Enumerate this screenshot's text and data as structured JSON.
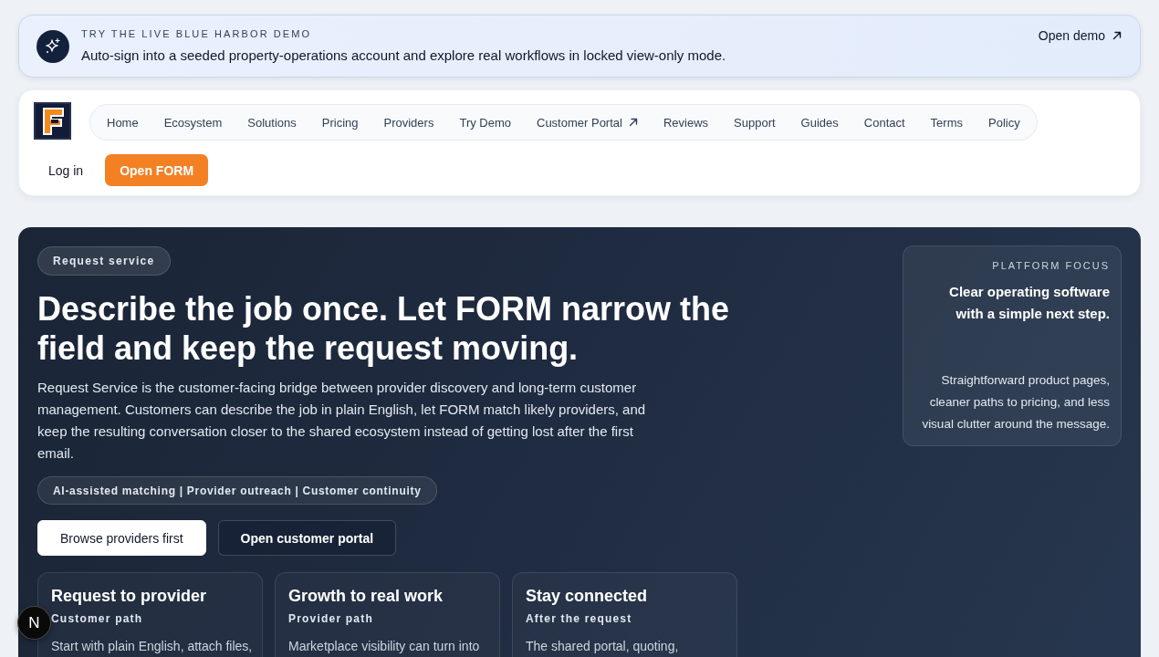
{
  "demo_banner": {
    "eyebrow": "TRY THE LIVE BLUE HARBOR DEMO",
    "message": "Auto-sign into a seeded property-operations account and explore real workflows in locked view-only mode.",
    "link": "Open demo"
  },
  "nav": {
    "items": [
      {
        "label": "Home",
        "external": false
      },
      {
        "label": "Ecosystem",
        "external": false
      },
      {
        "label": "Solutions",
        "external": false
      },
      {
        "label": "Pricing",
        "external": false
      },
      {
        "label": "Providers",
        "external": false
      },
      {
        "label": "Try Demo",
        "external": false
      },
      {
        "label": "Customer Portal",
        "external": true
      },
      {
        "label": "Reviews",
        "external": false
      },
      {
        "label": "Support",
        "external": false
      },
      {
        "label": "Guides",
        "external": false
      },
      {
        "label": "Contact",
        "external": false
      },
      {
        "label": "Terms",
        "external": false
      },
      {
        "label": "Policy",
        "external": false
      }
    ],
    "login": "Log in",
    "cta": "Open FORM"
  },
  "hero": {
    "badge": "Request service",
    "title": "Describe the job once. Let FORM narrow the field and keep the request moving.",
    "description": "Request Service is the customer-facing bridge between provider discovery and long-term customer management. Customers can describe the job in plain English, let FORM match likely providers, and keep the resulting conversation closer to the shared ecosystem instead of getting lost after the first email.",
    "tags": "AI-assisted matching | Provider outreach | Customer continuity",
    "buttons": [
      {
        "label": "Browse providers first",
        "kind": "primary"
      },
      {
        "label": "Open customer portal",
        "kind": "secondary"
      }
    ],
    "cards": [
      {
        "title": "Request to provider",
        "subtitle": "Customer path",
        "text": "Start with plain English, attach files,"
      },
      {
        "title": "Growth to real work",
        "subtitle": "Provider path",
        "text": "Marketplace visibility can turn into"
      },
      {
        "title": "Stay connected",
        "subtitle": "After the request",
        "text": "The shared portal, quoting,"
      }
    ],
    "focus_panel": {
      "eyebrow": "PLATFORM FOCUS",
      "title": "Clear operating software with a simple next step.",
      "text": "Straightforward product pages, cleaner paths to pricing, and less visual clutter around the message."
    }
  },
  "dev_badge": {
    "label": "N"
  }
}
